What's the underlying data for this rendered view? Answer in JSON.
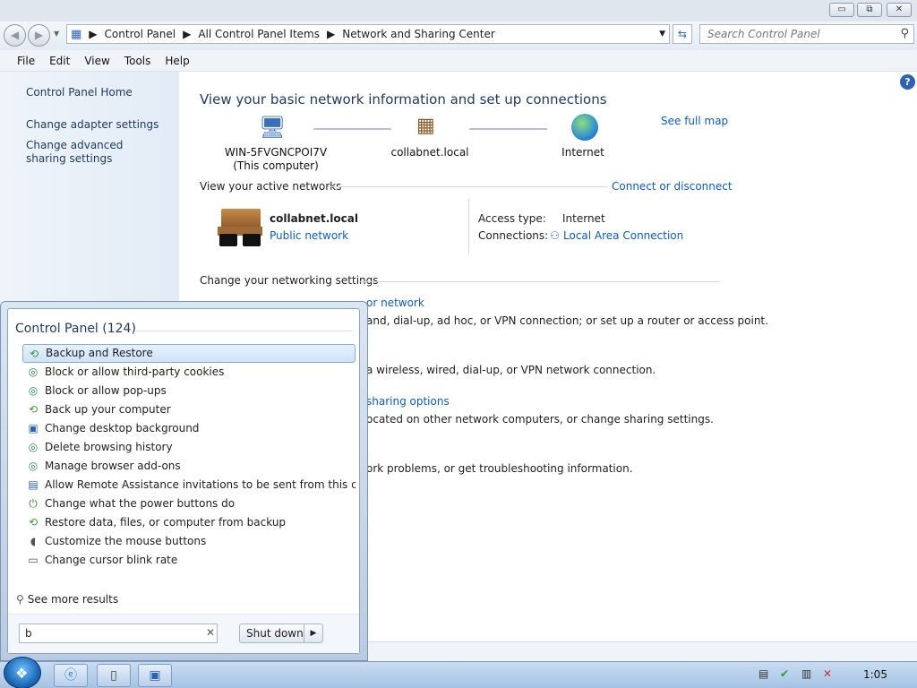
{
  "window": {
    "minimize": "▭",
    "maximize": "⧉",
    "close": "✕"
  },
  "address": {
    "crumbs": [
      "Control Panel",
      "All Control Panel Items",
      "Network and Sharing Center"
    ],
    "search_placeholder": "Search Control Panel"
  },
  "menu": [
    "File",
    "Edit",
    "View",
    "Tools",
    "Help"
  ],
  "left_pane": {
    "home": "Control Panel Home",
    "links": [
      "Change adapter settings",
      "Change advanced sharing settings"
    ]
  },
  "main": {
    "title": "View your basic network information and set up connections",
    "see_full_map": "See full map",
    "map": [
      {
        "label": "WIN-5FVGNCPOI7V",
        "sub": "(This computer)",
        "icon": "computer-icon"
      },
      {
        "label": "collabnet.local",
        "icon": "network-bench-icon"
      },
      {
        "label": "Internet",
        "icon": "globe-icon"
      }
    ],
    "active_networks_header": "View your active networks",
    "connect_or_disconnect": "Connect or disconnect",
    "network": {
      "name": "collabnet.local",
      "type_link": "Public network",
      "access_type_label": "Access type:",
      "access_type_value": "Internet",
      "connections_label": "Connections:",
      "connections_value": "Local Area Connection"
    },
    "networking_settings_header": "Change your networking settings",
    "partial_lines": [
      "or network",
      "and, dial-up, ad hoc, or VPN connection; or set up a router or access point.",
      "a wireless, wired, dial-up, or VPN network connection.",
      "sharing options",
      "ocated on other network computers, or change sharing settings.",
      "ork problems, or get troubleshooting information."
    ]
  },
  "start_menu": {
    "header": "Control Panel (124)",
    "items": [
      {
        "label": "Backup and Restore",
        "icon": "backup-icon",
        "selected": true
      },
      {
        "label": "Block or allow third-party cookies",
        "icon": "internet-options-icon"
      },
      {
        "label": "Block or allow pop-ups",
        "icon": "internet-options-icon"
      },
      {
        "label": "Back up your computer",
        "icon": "backup-icon"
      },
      {
        "label": "Change desktop background",
        "icon": "display-icon"
      },
      {
        "label": "Delete browsing history",
        "icon": "internet-options-icon"
      },
      {
        "label": "Manage browser add-ons",
        "icon": "internet-options-icon"
      },
      {
        "label": "Allow Remote Assistance invitations to be sent from this comp...",
        "icon": "system-icon"
      },
      {
        "label": "Change what the power buttons do",
        "icon": "power-icon"
      },
      {
        "label": "Restore data, files, or computer from backup",
        "icon": "backup-icon"
      },
      {
        "label": "Customize the mouse buttons",
        "icon": "mouse-icon"
      },
      {
        "label": "Change cursor blink rate",
        "icon": "keyboard-icon"
      }
    ],
    "see_more": "See more results",
    "search_value": "b",
    "shutdown": "Shut down"
  },
  "taskbar": {
    "clock": "1:05"
  },
  "colors": {
    "link": "#0e5ac1",
    "heading": "#1e395b",
    "selection": "#cfe3f8"
  }
}
